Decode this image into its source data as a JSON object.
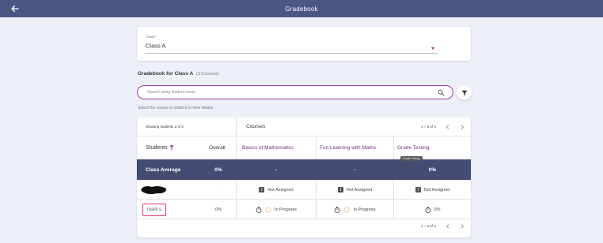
{
  "header": {
    "title": "Gradebook",
    "back_icon": "arrow-left-icon"
  },
  "class_select": {
    "label": "Class*",
    "value": "Class A"
  },
  "gradebook": {
    "title": "Gradebook for Class A",
    "subtitle": "(3 Courses)"
  },
  "search": {
    "placeholder": "Search using student name",
    "value": ""
  },
  "hint": "Select the course or student to view details.",
  "table": {
    "showing": "Showing students 2 of 2",
    "courses_label": "Courses",
    "pager": "1 – 3 of 3",
    "col_students": "Students",
    "sort_icon": "arrow-up-icon",
    "col_overall": "Overall",
    "courses": [
      "Basics of Mathematics",
      "Fun Learning with Maths",
      "Grade Testing"
    ],
    "tooltip": "Grade Testing",
    "average": {
      "label": "Class Average",
      "overall": "0%",
      "cells": [
        "-",
        "-",
        "0%"
      ]
    },
    "rows": [
      {
        "student": "",
        "overall": "-",
        "cells": [
          {
            "icon": "exclamation-icon",
            "text": "Not Assigned"
          },
          {
            "icon": "exclamation-icon",
            "text": "Not Assigned"
          },
          {
            "icon": "exclamation-icon",
            "text": "Not Assigned"
          }
        ]
      },
      {
        "student": "mark.s",
        "overall": "0%",
        "cells": [
          {
            "icon": "stopwatch-icon",
            "status_icon": "progress-icon",
            "text": "In Progress"
          },
          {
            "icon": "stopwatch-icon",
            "status_icon": "progress-icon",
            "text": "In Progress"
          },
          {
            "icon": "stopwatch-icon",
            "text": "0%"
          }
        ]
      }
    ],
    "footer_pager": "1 – 3 of 3"
  }
}
